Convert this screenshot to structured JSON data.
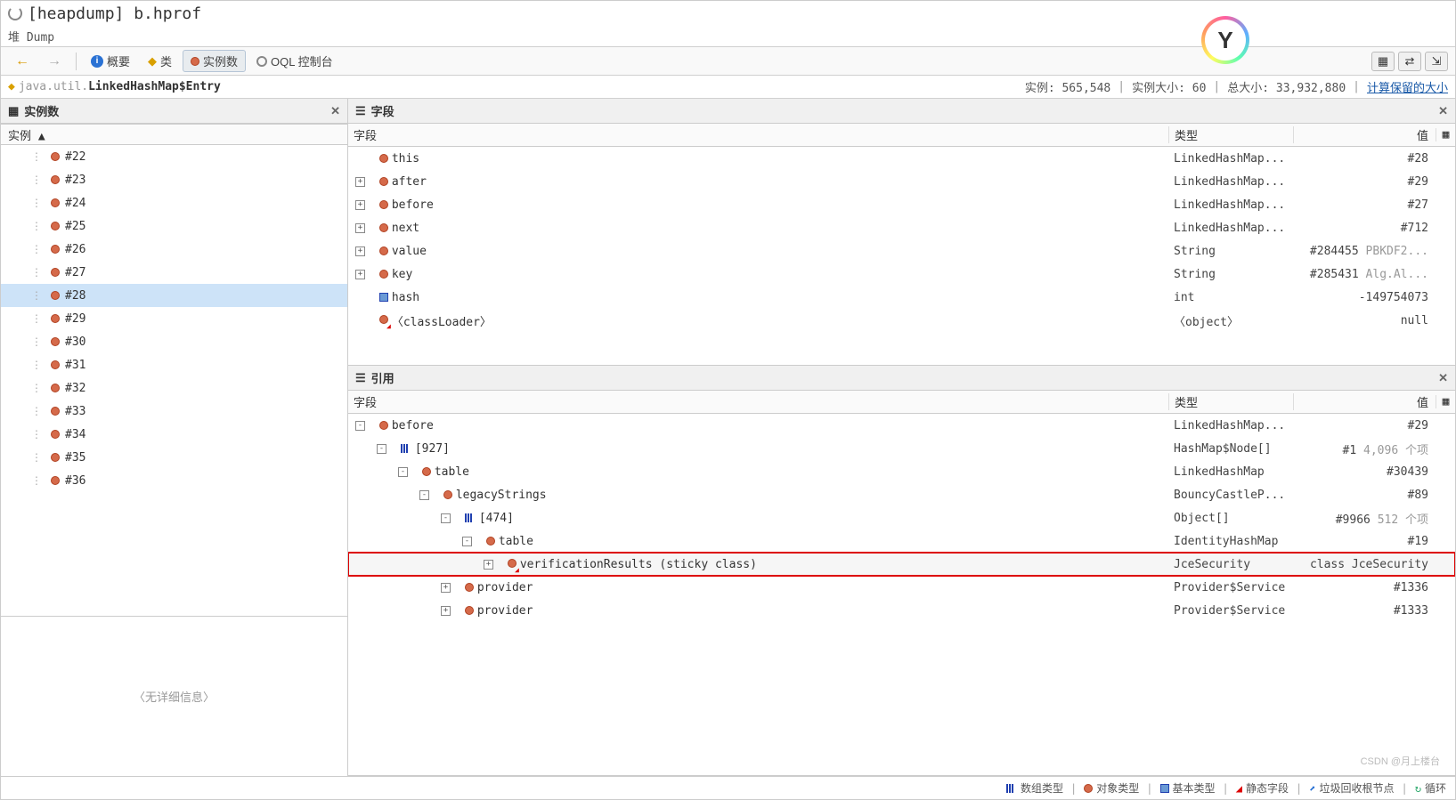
{
  "title": "[heapdump] b.hprof",
  "breadcrumb": "堆 Dump",
  "toolbar": {
    "back_icon": "←",
    "fwd_icon": "→",
    "overview": "概要",
    "classes": "类",
    "instances": "实例数",
    "oql": "OQL 控制台"
  },
  "class_header": {
    "name_prefix": "java.util.",
    "name_bold": "LinkedHashMap$Entry",
    "instances_label": "实例: 565,548",
    "instance_size_label": "实例大小: 60",
    "total_size_label": "总大小: 33,932,880",
    "compute_link": "计算保留的大小"
  },
  "instances_panel": {
    "title": "实例数",
    "col_header": "实例 ▲",
    "no_detail": "〈无详细信息〉",
    "items": [
      {
        "id": "#22"
      },
      {
        "id": "#23"
      },
      {
        "id": "#24"
      },
      {
        "id": "#25"
      },
      {
        "id": "#26"
      },
      {
        "id": "#27"
      },
      {
        "id": "#28",
        "selected": true
      },
      {
        "id": "#29"
      },
      {
        "id": "#30"
      },
      {
        "id": "#31"
      },
      {
        "id": "#32"
      },
      {
        "id": "#33"
      },
      {
        "id": "#34"
      },
      {
        "id": "#35"
      },
      {
        "id": "#36"
      }
    ]
  },
  "fields_panel": {
    "title": "字段",
    "columns": {
      "field": "字段",
      "type": "类型",
      "value": "值"
    },
    "rows": [
      {
        "indent": 0,
        "expander": null,
        "icon": "red",
        "name": "this",
        "type": "LinkedHashMap...",
        "value": "#28"
      },
      {
        "indent": 0,
        "expander": "+",
        "icon": "red",
        "name": "after",
        "type": "LinkedHashMap...",
        "value": "#29"
      },
      {
        "indent": 0,
        "expander": "+",
        "icon": "red",
        "name": "before",
        "type": "LinkedHashMap...",
        "value": "#27"
      },
      {
        "indent": 0,
        "expander": "+",
        "icon": "red",
        "name": "next",
        "type": "LinkedHashMap...",
        "value": "#712"
      },
      {
        "indent": 0,
        "expander": "+",
        "icon": "red",
        "name": "value",
        "type": "String",
        "value": "#284455",
        "extra": "PBKDF2..."
      },
      {
        "indent": 0,
        "expander": "+",
        "icon": "red",
        "name": "key",
        "type": "String",
        "value": "#285431",
        "extra": "Alg.Al..."
      },
      {
        "indent": 0,
        "expander": null,
        "icon": "sq",
        "name": "hash",
        "type": "int",
        "value": "-149754073"
      },
      {
        "indent": 0,
        "expander": null,
        "icon": "redx",
        "name": "〈classLoader〉",
        "type": "〈object〉",
        "value": "null"
      }
    ]
  },
  "refs_panel": {
    "title": "引用",
    "columns": {
      "field": "字段",
      "type": "类型",
      "value": "值"
    },
    "rows": [
      {
        "indent": 0,
        "expander": "-",
        "icon": "red",
        "name": "before",
        "type": "LinkedHashMap...",
        "value": "#29"
      },
      {
        "indent": 1,
        "expander": "-",
        "icon": "arr",
        "name": "[927]",
        "type": "HashMap$Node[]",
        "value": "#1",
        "extra": "4,096 个项"
      },
      {
        "indent": 2,
        "expander": "-",
        "icon": "red",
        "name": "table",
        "type": "LinkedHashMap",
        "value": "#30439"
      },
      {
        "indent": 3,
        "expander": "-",
        "icon": "red",
        "name": "legacyStrings",
        "type": "BouncyCastleP...",
        "value": "#89"
      },
      {
        "indent": 4,
        "expander": "-",
        "icon": "arr",
        "name": "[474]",
        "type": "Object[]",
        "value": "#9966",
        "extra": "512 个项"
      },
      {
        "indent": 5,
        "expander": "-",
        "icon": "red",
        "name": "table",
        "type": "IdentityHashMap",
        "value": "#19"
      },
      {
        "indent": 6,
        "expander": "+",
        "icon": "redx",
        "name": "verificationResults (sticky class)",
        "type": "JceSecurity",
        "value": "class JceSecurity",
        "highlight": true
      },
      {
        "indent": 4,
        "expander": "+",
        "icon": "red",
        "name": "provider",
        "type": "Provider$Service",
        "value": "#1336"
      },
      {
        "indent": 4,
        "expander": "+",
        "icon": "red",
        "name": "provider",
        "type": "Provider$Service",
        "value": "#1333"
      }
    ]
  },
  "status": {
    "array_type": "数组类型",
    "object_type": "对象类型",
    "primitive_type": "基本类型",
    "static_field": "静态字段",
    "gc_root": "垃圾回收根节点",
    "loop": "循环"
  },
  "watermark": "CSDN @月上楼台"
}
